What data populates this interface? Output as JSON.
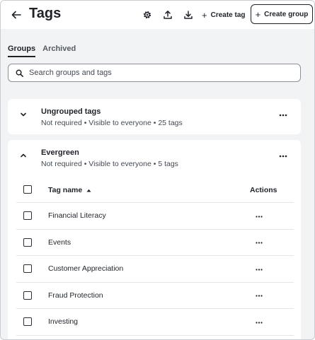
{
  "header": {
    "title": "Tags",
    "create_tag_label": "Create tag",
    "create_group_label": "Create group"
  },
  "tabs": [
    {
      "label": "Groups",
      "active": true
    },
    {
      "label": "Archived",
      "active": false
    }
  ],
  "search": {
    "placeholder": "Search groups and tags",
    "value": ""
  },
  "groups": [
    {
      "name": "Ungrouped tags",
      "meta": "Not required • Visible to everyone • 25 tags",
      "expanded": false
    },
    {
      "name": "Evergreen",
      "meta": "Not required • Visible to everyone • 5 tags",
      "expanded": true,
      "table": {
        "col_name": "Tag name",
        "col_actions": "Actions",
        "rows": [
          {
            "name": "Financial Literacy"
          },
          {
            "name": "Events"
          },
          {
            "name": "Customer Appreciation"
          },
          {
            "name": "Fraud Protection"
          },
          {
            "name": "Investing"
          }
        ]
      }
    }
  ],
  "icons": {
    "back": "arrow-left-icon",
    "settings": "gear-icon",
    "upload": "upload-icon",
    "download": "download-icon",
    "search": "search-icon",
    "more": "more-horizontal-icon",
    "sort": "sort-ascending-icon"
  },
  "colors": {
    "text": "#1f2328",
    "background": "#f2f3f5",
    "card": "#ffffff"
  }
}
